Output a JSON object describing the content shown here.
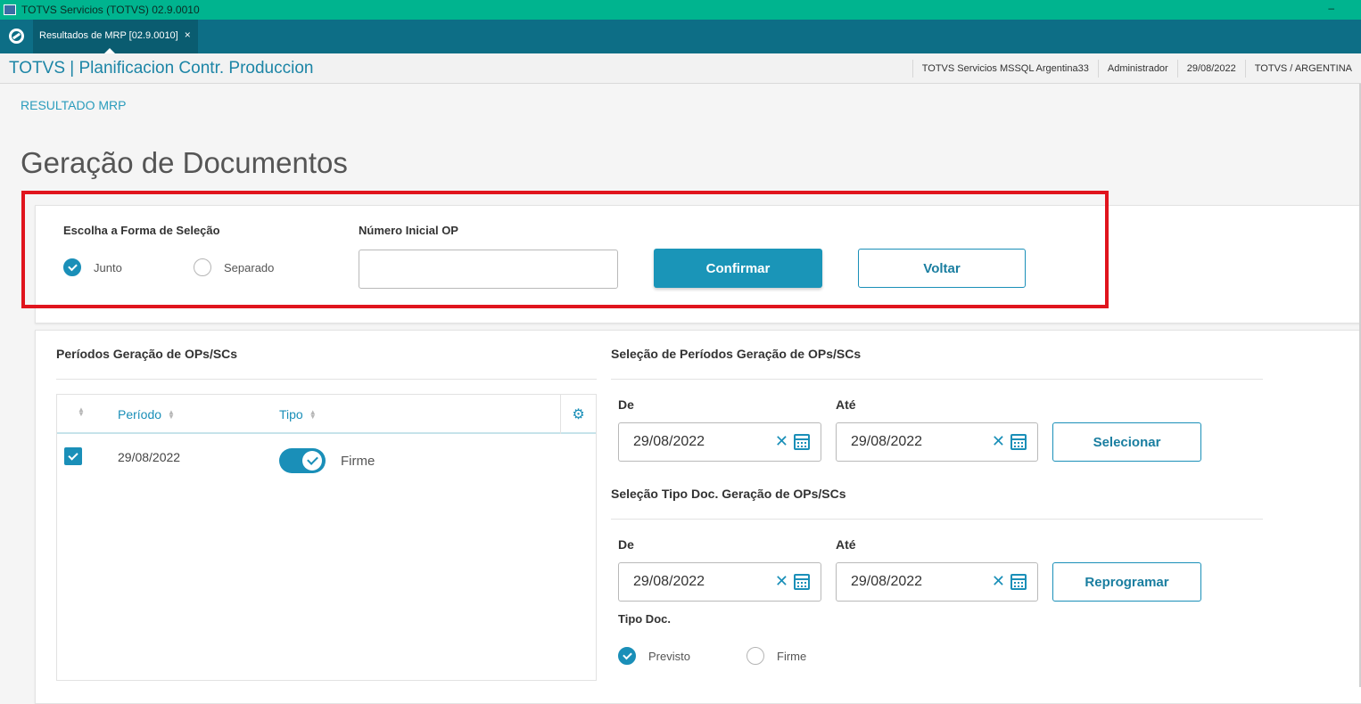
{
  "window": {
    "title": "TOTVS Servicios (TOTVS) 02.9.0010",
    "minimize": "–"
  },
  "tabs": [
    {
      "label": "Resultados de MRP [02.9.0010]",
      "close": "×"
    }
  ],
  "header": {
    "app_title": "TOTVS | Planificacion Contr. Produccion",
    "environment": "TOTVS Servicios MSSQL Argentina33",
    "user": "Administrador",
    "date": "29/08/2022",
    "company": "TOTVS / ARGENTINA"
  },
  "breadcrumb": "RESULTADO MRP",
  "page_title": "Geração de Documentos",
  "selection": {
    "label": "Escolha a Forma de Seleção",
    "options": [
      {
        "label": "Junto",
        "checked": true
      },
      {
        "label": "Separado",
        "checked": false
      }
    ],
    "op_label": "Número Inicial OP",
    "op_value": "",
    "confirm": "Confirmar",
    "back": "Voltar"
  },
  "periods": {
    "title": "Períodos Geração de OPs/SCs",
    "columns": [
      "Período",
      "Tipo"
    ],
    "rows": [
      {
        "selected": true,
        "period": "29/08/2022",
        "type": "Firme",
        "type_on": true
      }
    ]
  },
  "period_selection": {
    "title": "Seleção de Períodos Geração de OPs/SCs",
    "from_label": "De",
    "to_label": "Até",
    "from": "29/08/2022",
    "to": "29/08/2022",
    "button": "Selecionar"
  },
  "type_selection": {
    "title": "Seleção Tipo Doc. Geração de OPs/SCs",
    "from_label": "De",
    "to_label": "Até",
    "from": "29/08/2022",
    "to": "29/08/2022",
    "button": "Reprogramar",
    "doc_type_label": "Tipo Doc.",
    "options": [
      {
        "label": "Previsto",
        "checked": true
      },
      {
        "label": "Firme",
        "checked": false
      }
    ]
  },
  "icons": {
    "clear": "✕",
    "settings": "⚙"
  },
  "colors": {
    "titlebar": "#00b48f",
    "tabbar": "#0d6e86",
    "accent": "#1a8fb8",
    "highlight": "#e0141d"
  }
}
